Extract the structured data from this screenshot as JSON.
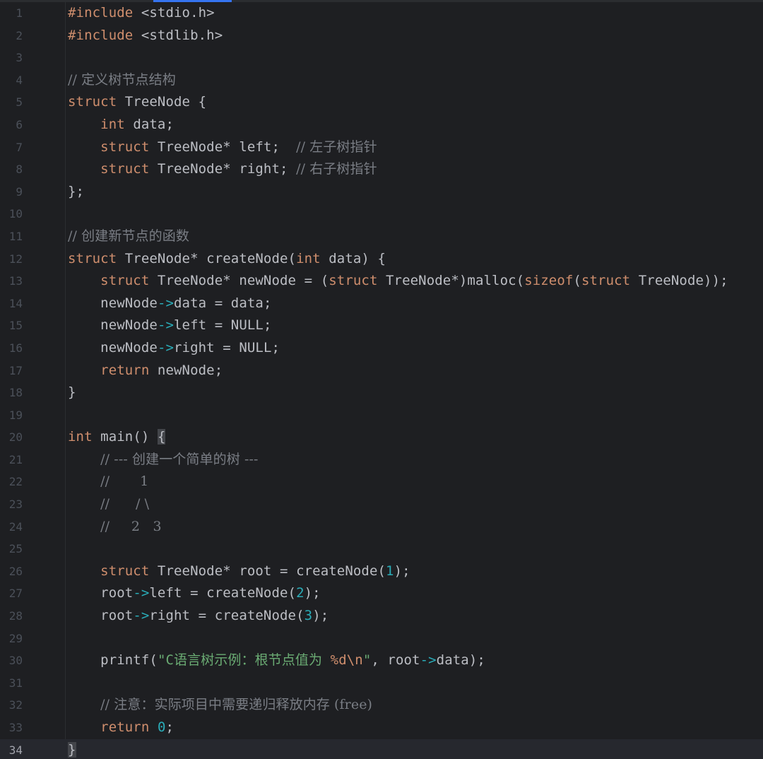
{
  "editor": {
    "current_line": 34,
    "lines": [
      {
        "n": "1",
        "tokens": [
          {
            "t": "#include",
            "c": "kw"
          },
          {
            "t": " <stdio.h>",
            "c": "pl"
          }
        ]
      },
      {
        "n": "2",
        "tokens": [
          {
            "t": "#include",
            "c": "kw"
          },
          {
            "t": " <stdlib.h>",
            "c": "pl"
          }
        ]
      },
      {
        "n": "3",
        "tokens": []
      },
      {
        "n": "4",
        "tokens": [
          {
            "t": "// 定义树节点结构",
            "c": "cm"
          }
        ]
      },
      {
        "n": "5",
        "tokens": [
          {
            "t": "struct",
            "c": "kw"
          },
          {
            "t": " TreeNode {",
            "c": "pl"
          }
        ]
      },
      {
        "n": "6",
        "tokens": [
          {
            "t": "    ",
            "c": "pl"
          },
          {
            "t": "int",
            "c": "kw"
          },
          {
            "t": " data;",
            "c": "pl"
          }
        ]
      },
      {
        "n": "7",
        "tokens": [
          {
            "t": "    ",
            "c": "pl"
          },
          {
            "t": "struct",
            "c": "kw"
          },
          {
            "t": " TreeNode* left;  ",
            "c": "pl"
          },
          {
            "t": "// 左子树指针",
            "c": "cm"
          }
        ]
      },
      {
        "n": "8",
        "tokens": [
          {
            "t": "    ",
            "c": "pl"
          },
          {
            "t": "struct",
            "c": "kw"
          },
          {
            "t": " TreeNode* right; ",
            "c": "pl"
          },
          {
            "t": "// 右子树指针",
            "c": "cm"
          }
        ]
      },
      {
        "n": "9",
        "tokens": [
          {
            "t": "};",
            "c": "pl"
          }
        ]
      },
      {
        "n": "10",
        "tokens": []
      },
      {
        "n": "11",
        "tokens": [
          {
            "t": "// 创建新节点的函数",
            "c": "cm"
          }
        ]
      },
      {
        "n": "12",
        "tokens": [
          {
            "t": "struct",
            "c": "kw"
          },
          {
            "t": " TreeNode* createNode(",
            "c": "pl"
          },
          {
            "t": "int",
            "c": "kw"
          },
          {
            "t": " data) {",
            "c": "pl"
          }
        ]
      },
      {
        "n": "13",
        "tokens": [
          {
            "t": "    ",
            "c": "pl"
          },
          {
            "t": "struct",
            "c": "kw"
          },
          {
            "t": " TreeNode* newNode = (",
            "c": "pl"
          },
          {
            "t": "struct",
            "c": "kw"
          },
          {
            "t": " TreeNode*)malloc(",
            "c": "pl"
          },
          {
            "t": "sizeof",
            "c": "kw"
          },
          {
            "t": "(",
            "c": "pl"
          },
          {
            "t": "struct",
            "c": "kw"
          },
          {
            "t": " TreeNode));",
            "c": "pl"
          }
        ]
      },
      {
        "n": "14",
        "tokens": [
          {
            "t": "    newNode",
            "c": "pl"
          },
          {
            "t": "->",
            "c": "op"
          },
          {
            "t": "data = data;",
            "c": "pl"
          }
        ]
      },
      {
        "n": "15",
        "tokens": [
          {
            "t": "    newNode",
            "c": "pl"
          },
          {
            "t": "->",
            "c": "op"
          },
          {
            "t": "left = NULL;",
            "c": "pl"
          }
        ]
      },
      {
        "n": "16",
        "tokens": [
          {
            "t": "    newNode",
            "c": "pl"
          },
          {
            "t": "->",
            "c": "op"
          },
          {
            "t": "right = NULL;",
            "c": "pl"
          }
        ]
      },
      {
        "n": "17",
        "tokens": [
          {
            "t": "    ",
            "c": "pl"
          },
          {
            "t": "return",
            "c": "kw"
          },
          {
            "t": " newNode;",
            "c": "pl"
          }
        ]
      },
      {
        "n": "18",
        "tokens": [
          {
            "t": "}",
            "c": "pl"
          }
        ]
      },
      {
        "n": "19",
        "tokens": []
      },
      {
        "n": "20",
        "tokens": [
          {
            "t": "int",
            "c": "kw"
          },
          {
            "t": " main() ",
            "c": "pl"
          },
          {
            "t": "{",
            "c": "cursor-brace"
          }
        ]
      },
      {
        "n": "21",
        "tokens": [
          {
            "t": "    ",
            "c": "pl"
          },
          {
            "t": "// --- 创建一个简单的树 ---",
            "c": "cm"
          }
        ]
      },
      {
        "n": "22",
        "tokens": [
          {
            "t": "    ",
            "c": "pl"
          },
          {
            "t": "//       1",
            "c": "cm"
          }
        ]
      },
      {
        "n": "23",
        "tokens": [
          {
            "t": "    ",
            "c": "pl"
          },
          {
            "t": "//      / \\",
            "c": "cm"
          }
        ]
      },
      {
        "n": "24",
        "tokens": [
          {
            "t": "    ",
            "c": "pl"
          },
          {
            "t": "//     2   3",
            "c": "cm"
          }
        ]
      },
      {
        "n": "25",
        "tokens": []
      },
      {
        "n": "26",
        "tokens": [
          {
            "t": "    ",
            "c": "pl"
          },
          {
            "t": "struct",
            "c": "kw"
          },
          {
            "t": " TreeNode* root = createNode(",
            "c": "pl"
          },
          {
            "t": "1",
            "c": "num"
          },
          {
            "t": ");",
            "c": "pl"
          }
        ]
      },
      {
        "n": "27",
        "tokens": [
          {
            "t": "    root",
            "c": "pl"
          },
          {
            "t": "->",
            "c": "op"
          },
          {
            "t": "left = createNode(",
            "c": "pl"
          },
          {
            "t": "2",
            "c": "num"
          },
          {
            "t": ");",
            "c": "pl"
          }
        ]
      },
      {
        "n": "28",
        "tokens": [
          {
            "t": "    root",
            "c": "pl"
          },
          {
            "t": "->",
            "c": "op"
          },
          {
            "t": "right = createNode(",
            "c": "pl"
          },
          {
            "t": "3",
            "c": "num"
          },
          {
            "t": ");",
            "c": "pl"
          }
        ]
      },
      {
        "n": "29",
        "tokens": []
      },
      {
        "n": "30",
        "tokens": [
          {
            "t": "    printf(",
            "c": "pl"
          },
          {
            "t": "\"C语言树示例：根节点值为 ",
            "c": "str"
          },
          {
            "t": "%d",
            "c": "fmt"
          },
          {
            "t": "\\n",
            "c": "esc"
          },
          {
            "t": "\"",
            "c": "str"
          },
          {
            "t": ", root",
            "c": "pl"
          },
          {
            "t": "->",
            "c": "op"
          },
          {
            "t": "data);",
            "c": "pl"
          }
        ]
      },
      {
        "n": "31",
        "tokens": []
      },
      {
        "n": "32",
        "tokens": [
          {
            "t": "    ",
            "c": "pl"
          },
          {
            "t": "// 注意：实际项目中需要递归释放内存 (free)",
            "c": "cm"
          }
        ]
      },
      {
        "n": "33",
        "tokens": [
          {
            "t": "    ",
            "c": "pl"
          },
          {
            "t": "return",
            "c": "kw"
          },
          {
            "t": " ",
            "c": "pl"
          },
          {
            "t": "0",
            "c": "num"
          },
          {
            "t": ";",
            "c": "pl"
          }
        ]
      },
      {
        "n": "34",
        "tokens": [
          {
            "t": "}",
            "c": "cursor-brace"
          }
        ]
      }
    ]
  }
}
